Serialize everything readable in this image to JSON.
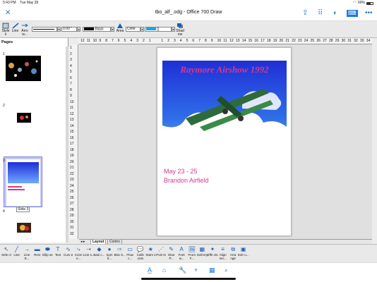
{
  "status": {
    "time": "5:43 PM",
    "date": "Tue May 28",
    "battery": "60%"
  },
  "window": {
    "title": "tbo_alf_.odg - Office 700 Draw"
  },
  "toolbar": {
    "style_label": "Style s",
    "line_label": "Line",
    "arrow_label": "Arro w...",
    "line_width": "0.00 \"",
    "line_color": "Black",
    "area_label": "Area",
    "fill_type": "Color",
    "fill_name": "[]",
    "shadow_label": "Shad ow"
  },
  "pages_panel": {
    "header": "Pages",
    "items": [
      {
        "number": "1",
        "label": ""
      },
      {
        "number": "2",
        "label": ""
      },
      {
        "number": "3",
        "label": "Slide 3"
      },
      {
        "number": "4",
        "label": ""
      }
    ]
  },
  "ruler": {
    "h_ticks": [
      "12",
      "11",
      "10",
      "9",
      "8",
      "7",
      "6",
      "5",
      "4",
      "3",
      "2",
      "1",
      "",
      "1",
      "2",
      "3",
      "4",
      "5",
      "6",
      "7",
      "8",
      "9",
      "10",
      "11",
      "12",
      "13",
      "14",
      "15",
      "16",
      "17",
      "18",
      "19",
      "20",
      "21",
      "22",
      "23",
      "24",
      "25",
      "26",
      "27",
      "28",
      "29",
      "30",
      "31",
      "32",
      "33",
      "34"
    ],
    "v_ticks": [
      "1",
      "2",
      "3",
      "4",
      "5",
      "6",
      "7",
      "8",
      "9",
      "10",
      "11",
      "12",
      "13",
      "14",
      "15",
      "16",
      "17",
      "18",
      "19",
      "20",
      "21",
      "22",
      "23",
      "24",
      "25",
      "26",
      "27",
      "28",
      "29",
      "30",
      "31",
      "32"
    ]
  },
  "poster": {
    "headline": "Raymore Airshow 1992",
    "dates": "May 23 - 25",
    "location": "Brandon Airfield"
  },
  "tabs": {
    "layout": "Layout",
    "controls": "Contro"
  },
  "drawing_tools": [
    {
      "label": "Sele ct",
      "icon": "pointer-icon",
      "glyph": "↖"
    },
    {
      "label": "Line",
      "icon": "line-icon",
      "glyph": "╱"
    },
    {
      "label": "Line E...",
      "icon": "line-ends-icon",
      "glyph": "→"
    },
    {
      "label": "Rect",
      "icon": "rectangle-icon",
      "glyph": "▬"
    },
    {
      "label": "Ellip se",
      "icon": "ellipse-icon",
      "glyph": "⬬"
    },
    {
      "label": "Text",
      "icon": "text-icon",
      "glyph": "T"
    },
    {
      "label": "Curv e",
      "icon": "curve-icon",
      "glyph": "∿"
    },
    {
      "label": "Conn e...",
      "icon": "connector-icon",
      "glyph": "⤷"
    },
    {
      "label": "Line s...",
      "icon": "lines-arrows-icon",
      "glyph": "⇢"
    },
    {
      "label": "Basi c...",
      "icon": "basic-shapes-icon",
      "glyph": "◆"
    },
    {
      "label": "Sym b...",
      "icon": "symbol-shapes-icon",
      "glyph": "●"
    },
    {
      "label": "Bloc k...",
      "icon": "block-arrows-icon",
      "glyph": "⇨"
    },
    {
      "label": "Flow c...",
      "icon": "flowchart-icon",
      "glyph": "▭"
    },
    {
      "label": "Calls outs",
      "icon": "callouts-icon",
      "glyph": "💬"
    },
    {
      "label": "Stars s",
      "icon": "stars-icon",
      "glyph": "★"
    },
    {
      "label": "Poin ts",
      "icon": "points-icon",
      "glyph": "⋰"
    },
    {
      "label": "Glue P...",
      "icon": "glue-points-icon",
      "glyph": "✎"
    },
    {
      "label": "Font w...",
      "icon": "fontwork-icon",
      "glyph": "A"
    },
    {
      "label": "From F...",
      "icon": "from-file-icon",
      "glyph": "🖼"
    },
    {
      "label": "Gall ery",
      "icon": "gallery-icon",
      "glyph": "▦"
    },
    {
      "label": "Effe cts",
      "icon": "effects-icon",
      "glyph": "✦"
    },
    {
      "label": "Align me...",
      "icon": "align-icon",
      "glyph": "≡"
    },
    {
      "label": "Arra nge",
      "icon": "arrange-icon",
      "glyph": "⧉"
    },
    {
      "label": "Extr u...",
      "icon": "extrusion-icon",
      "glyph": "▣"
    }
  ],
  "colors": {
    "accent": "#1a7bd9",
    "headline": "#d23a8e",
    "sky": "#1f2fd6",
    "plane": "#2e6b3a"
  }
}
